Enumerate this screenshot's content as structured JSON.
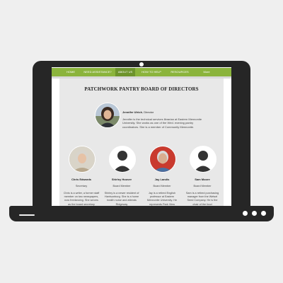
{
  "nav": {
    "items": [
      {
        "label": "HOME"
      },
      {
        "label": "NEED ASSISTANCE?"
      },
      {
        "label": "ABOUT US",
        "active": true
      },
      {
        "label": "HOW TO HELP"
      },
      {
        "label": "RESOURCES"
      },
      {
        "label": "More"
      }
    ],
    "color": "#8bb43c"
  },
  "page": {
    "title": "PATCHWORK PANTRY BOARD OF DIRECTORS",
    "featured": {
      "name": "Jennifer Ulrich",
      "role": ", Director",
      "bio": "Jennifer is the technical services librarian at Eastern Mennonite University.  She works as one of the Wed. evening pantry coordinators.  She is a member of Community Mennonite."
    },
    "members": [
      {
        "name": "Chris Edwards",
        "role": "Secretary",
        "bio": "Chris is a writer, a former staff member on two newspapers, now freelancing. She serves as the board secretary"
      },
      {
        "name": "Shirley Hoover",
        "role": "Board Member",
        "bio": "Shirley is a newer resident of Harrisonburg.  She is a home health nurse and attends Ridgeway"
      },
      {
        "name": "Jay Landis",
        "role": "Board Member",
        "bio": "Jay is a retired English professor at Eastern Mennonite University. He represents Park View Mennonite Church, one"
      },
      {
        "name": "Sam Moore",
        "role": "Board Member",
        "bio": "Sam is a retired purchasing manager from the Wetsel Seed Company.  He is the chair of the food"
      }
    ]
  }
}
